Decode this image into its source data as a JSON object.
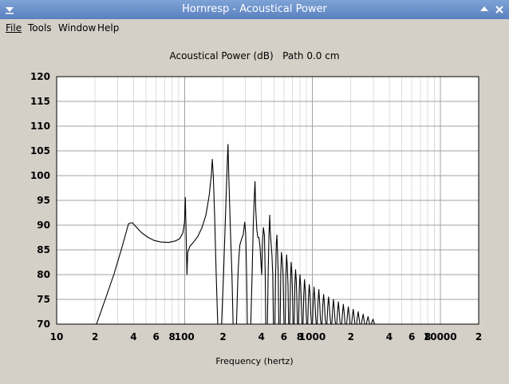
{
  "window": {
    "title": "Hornresp - Acoustical Power"
  },
  "menu": {
    "items": [
      {
        "id": "file",
        "label": "File"
      },
      {
        "id": "tools",
        "label": "Tools"
      },
      {
        "id": "window",
        "label": "Window"
      },
      {
        "id": "help",
        "label": "Help"
      }
    ]
  },
  "colors": {
    "titlebar": "#6b8fcb",
    "plot_background": "#ffffff",
    "grid_major": "#a0a0a0",
    "grid_minor": "#dcdcdc",
    "curve": "#000000"
  },
  "chart_data": {
    "type": "line",
    "title": "Acoustical Power (dB)   Path 0.0 cm",
    "xlabel": "Frequency (hertz)",
    "ylabel": "",
    "x_scale": "log",
    "xlim": [
      10,
      20000
    ],
    "ylim": [
      70,
      120
    ],
    "grid": true,
    "y_ticks": [
      "70",
      "75",
      "80",
      "85",
      "90",
      "95",
      "100",
      "105",
      "110",
      "115",
      "120"
    ],
    "x_ticks": [
      {
        "value": 10,
        "label": "10"
      },
      {
        "value": 20,
        "label": "2"
      },
      {
        "value": 40,
        "label": "4"
      },
      {
        "value": 60,
        "label": "6"
      },
      {
        "value": 80,
        "label": "8"
      },
      {
        "value": 100,
        "label": "100"
      },
      {
        "value": 200,
        "label": "2"
      },
      {
        "value": 400,
        "label": "4"
      },
      {
        "value": 600,
        "label": "6"
      },
      {
        "value": 800,
        "label": "8"
      },
      {
        "value": 1000,
        "label": "1000"
      },
      {
        "value": 2000,
        "label": "2"
      },
      {
        "value": 4000,
        "label": "4"
      },
      {
        "value": 6000,
        "label": "6"
      },
      {
        "value": 8000,
        "label": "8"
      },
      {
        "value": 10000,
        "label": "10000"
      },
      {
        "value": 20000,
        "label": "2"
      }
    ],
    "series": [
      {
        "points": [
          [
            20.5,
            70
          ],
          [
            24,
            75
          ],
          [
            28,
            80
          ],
          [
            32,
            85
          ],
          [
            34.5,
            88
          ],
          [
            36.5,
            90.3
          ],
          [
            39,
            90.5
          ],
          [
            42,
            89.6
          ],
          [
            46,
            88.5
          ],
          [
            52,
            87.5
          ],
          [
            58,
            86.9
          ],
          [
            65,
            86.6
          ],
          [
            75,
            86.5
          ],
          [
            85,
            86.8
          ],
          [
            92,
            87.3
          ],
          [
            97,
            88.4
          ],
          [
            100,
            90.5
          ],
          [
            101.5,
            95.6
          ],
          [
            103,
            88
          ],
          [
            104.5,
            80
          ],
          [
            106,
            84.5
          ],
          [
            110,
            85.7
          ],
          [
            118,
            86.6
          ],
          [
            127,
            87.7
          ],
          [
            137,
            89.5
          ],
          [
            147,
            92
          ],
          [
            156,
            96
          ],
          [
            162,
            100
          ],
          [
            165,
            103.3
          ],
          [
            168,
            100
          ],
          [
            172,
            92
          ],
          [
            177,
            80
          ],
          [
            182,
            70
          ],
          [
            195,
            70
          ],
          [
            202,
            80
          ],
          [
            208,
            90
          ],
          [
            213,
            98
          ],
          [
            217,
            104
          ],
          [
            219,
            106.3
          ],
          [
            222,
            100
          ],
          [
            228,
            90
          ],
          [
            235,
            80
          ],
          [
            240,
            70
          ],
          [
            255,
            70
          ],
          [
            262,
            80
          ],
          [
            266,
            83.3
          ],
          [
            271,
            86
          ],
          [
            279,
            87.1
          ],
          [
            288,
            88.1
          ],
          [
            296,
            90.6
          ],
          [
            301,
            88.3
          ],
          [
            306,
            80
          ],
          [
            310,
            70
          ],
          [
            330,
            70
          ],
          [
            338,
            80
          ],
          [
            345,
            90
          ],
          [
            352,
            96
          ],
          [
            356,
            98.8
          ],
          [
            361,
            93
          ],
          [
            368,
            89
          ],
          [
            375,
            87.5
          ],
          [
            382,
            87.5
          ],
          [
            390,
            85.5
          ],
          [
            397,
            82
          ],
          [
            402,
            80
          ],
          [
            407,
            86
          ],
          [
            414,
            89.5
          ],
          [
            422,
            88
          ],
          [
            428,
            80
          ],
          [
            432,
            70
          ],
          [
            445,
            70
          ],
          [
            451,
            80
          ],
          [
            458,
            88
          ],
          [
            464,
            92
          ],
          [
            468,
            89
          ],
          [
            475,
            86.5
          ],
          [
            483,
            84
          ],
          [
            490,
            80
          ],
          [
            496,
            70
          ],
          [
            510,
            70
          ],
          [
            516,
            80
          ],
          [
            522,
            86
          ],
          [
            528,
            88
          ],
          [
            534,
            85
          ],
          [
            541,
            80
          ],
          [
            546,
            70
          ],
          [
            560,
            70
          ],
          [
            566,
            80
          ],
          [
            573,
            84.5
          ],
          [
            581,
            83
          ],
          [
            590,
            80
          ],
          [
            600,
            70
          ],
          [
            614,
            70
          ],
          [
            621,
            80
          ],
          [
            629,
            84
          ],
          [
            636,
            82
          ],
          [
            645,
            78
          ],
          [
            652,
            70
          ],
          [
            666,
            70
          ],
          [
            674,
            78
          ],
          [
            682,
            82.5
          ],
          [
            691,
            80.5
          ],
          [
            700,
            76
          ],
          [
            707,
            70
          ],
          [
            722,
            70
          ],
          [
            730,
            78
          ],
          [
            739,
            81
          ],
          [
            748,
            79
          ],
          [
            757,
            75
          ],
          [
            764,
            70
          ],
          [
            780,
            70
          ],
          [
            790,
            77
          ],
          [
            800,
            80
          ],
          [
            810,
            78
          ],
          [
            821,
            74
          ],
          [
            830,
            70
          ],
          [
            846,
            70
          ],
          [
            857,
            76
          ],
          [
            868,
            79
          ],
          [
            880,
            77
          ],
          [
            892,
            73
          ],
          [
            902,
            70
          ],
          [
            920,
            70
          ],
          [
            933,
            75.5
          ],
          [
            946,
            78
          ],
          [
            959,
            76
          ],
          [
            973,
            72
          ],
          [
            985,
            70
          ],
          [
            1003,
            70
          ],
          [
            1017,
            75
          ],
          [
            1032,
            77.5
          ],
          [
            1046,
            75
          ],
          [
            1061,
            71.5
          ],
          [
            1072,
            70
          ],
          [
            1092,
            70
          ],
          [
            1108,
            74.5
          ],
          [
            1124,
            77
          ],
          [
            1140,
            74.5
          ],
          [
            1156,
            71
          ],
          [
            1170,
            70
          ],
          [
            1190,
            70
          ],
          [
            1207,
            74
          ],
          [
            1225,
            76
          ],
          [
            1243,
            74
          ],
          [
            1261,
            71
          ],
          [
            1278,
            70
          ],
          [
            1300,
            70
          ],
          [
            1319,
            73.5
          ],
          [
            1339,
            75.5
          ],
          [
            1359,
            73.5
          ],
          [
            1379,
            71
          ],
          [
            1396,
            70
          ],
          [
            1420,
            70
          ],
          [
            1441,
            73
          ],
          [
            1463,
            75
          ],
          [
            1485,
            73
          ],
          [
            1507,
            70.5
          ],
          [
            1526,
            70
          ],
          [
            1552,
            70
          ],
          [
            1575,
            72.5
          ],
          [
            1599,
            74.5
          ],
          [
            1623,
            72.5
          ],
          [
            1647,
            70.3
          ],
          [
            1668,
            70
          ],
          [
            1697,
            70
          ],
          [
            1722,
            72.3
          ],
          [
            1748,
            74
          ],
          [
            1775,
            72.2
          ],
          [
            1801,
            70.2
          ],
          [
            1824,
            70
          ],
          [
            1855,
            70
          ],
          [
            1883,
            72
          ],
          [
            1912,
            73.5
          ],
          [
            1941,
            71.8
          ],
          [
            1970,
            70
          ],
          [
            2028,
            70
          ],
          [
            2059,
            71.7
          ],
          [
            2090,
            73
          ],
          [
            2122,
            71.5
          ],
          [
            2153,
            70
          ],
          [
            2217,
            70
          ],
          [
            2250,
            71.4
          ],
          [
            2284,
            72.5
          ],
          [
            2319,
            71.2
          ],
          [
            2353,
            70
          ],
          [
            2423,
            70
          ],
          [
            2460,
            71.1
          ],
          [
            2497,
            72
          ],
          [
            2535,
            70.9
          ],
          [
            2572,
            70
          ],
          [
            2649,
            70
          ],
          [
            2689,
            70.9
          ],
          [
            2730,
            71.5
          ],
          [
            2771,
            70.6
          ],
          [
            2812,
            70
          ],
          [
            2896,
            70
          ],
          [
            2940,
            70.6
          ],
          [
            2984,
            71
          ],
          [
            3029,
            70.4
          ],
          [
            3074,
            70
          ]
        ]
      }
    ]
  }
}
